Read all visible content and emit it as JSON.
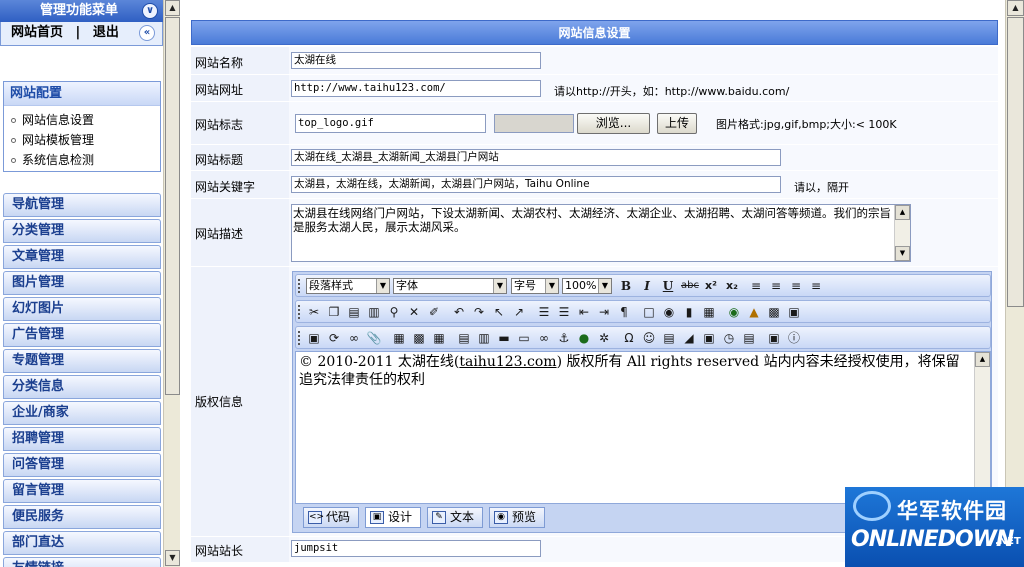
{
  "sidebar": {
    "header": "管理功能菜单",
    "links": [
      "网站首页",
      "退出"
    ],
    "link_sep": "|",
    "config_box": {
      "title": "网站配置",
      "items": [
        "网站信息设置",
        "网站模板管理",
        "系统信息检测"
      ]
    },
    "nav": [
      "导航管理",
      "分类管理",
      "文章管理",
      "图片管理",
      "幻灯图片",
      "广告管理",
      "专题管理",
      "分类信息",
      "企业/商家",
      "招聘管理",
      "问答管理",
      "留言管理",
      "便民服务",
      "部门直达",
      "友情链接"
    ]
  },
  "main": {
    "title": "网站信息设置",
    "site_name": {
      "label": "网站名称",
      "value": "太湖在线"
    },
    "site_url": {
      "label": "网站网址",
      "value": "http://www.taihu123.com/",
      "hint": "请以http://开头，如：http://www.baidu.com/"
    },
    "site_logo": {
      "label": "网站标志",
      "value": "top_logo.gif",
      "browse": "浏览...",
      "upload": "上传",
      "hint": "图片格式:jpg,gif,bmp;大小:< 100K"
    },
    "site_title": {
      "label": "网站标题",
      "value": "太湖在线_太湖县_太湖新闻_太湖县门户网站"
    },
    "site_keywords": {
      "label": "网站关键字",
      "value": "太湖县，太湖在线，太湖新闻，太湖县门户网站，Taihu Online",
      "hint": "请以，隔开"
    },
    "site_desc": {
      "label": "网站描述",
      "value": "太湖县在线网络门户网站，下设太湖新闻、太湖农村、太湖经济、太湖企业、太湖招聘、太湖问答等频道。我们的宗旨是服务太湖人民，展示太湖风采。"
    },
    "copyright": {
      "label": "版权信息",
      "toolbar": {
        "paragraph": "段落样式",
        "font": "字体",
        "size": "字号",
        "zoom": "100%"
      },
      "content_prefix": "© 2010-2011 太湖在线(",
      "content_link": "taihu123.com",
      "content_suffix": ") 版权所有  All rights reserved 站内内容未经授权使用，将保留追究法律责任的权利",
      "modes": [
        "代码",
        "设计",
        "文本",
        "预览"
      ]
    },
    "webmaster": {
      "label": "网站站长",
      "value": "jumpsit"
    }
  },
  "watermark": {
    "cn": "华军软件园",
    "en": "ONLINEDOWN",
    "net": ".NET"
  }
}
